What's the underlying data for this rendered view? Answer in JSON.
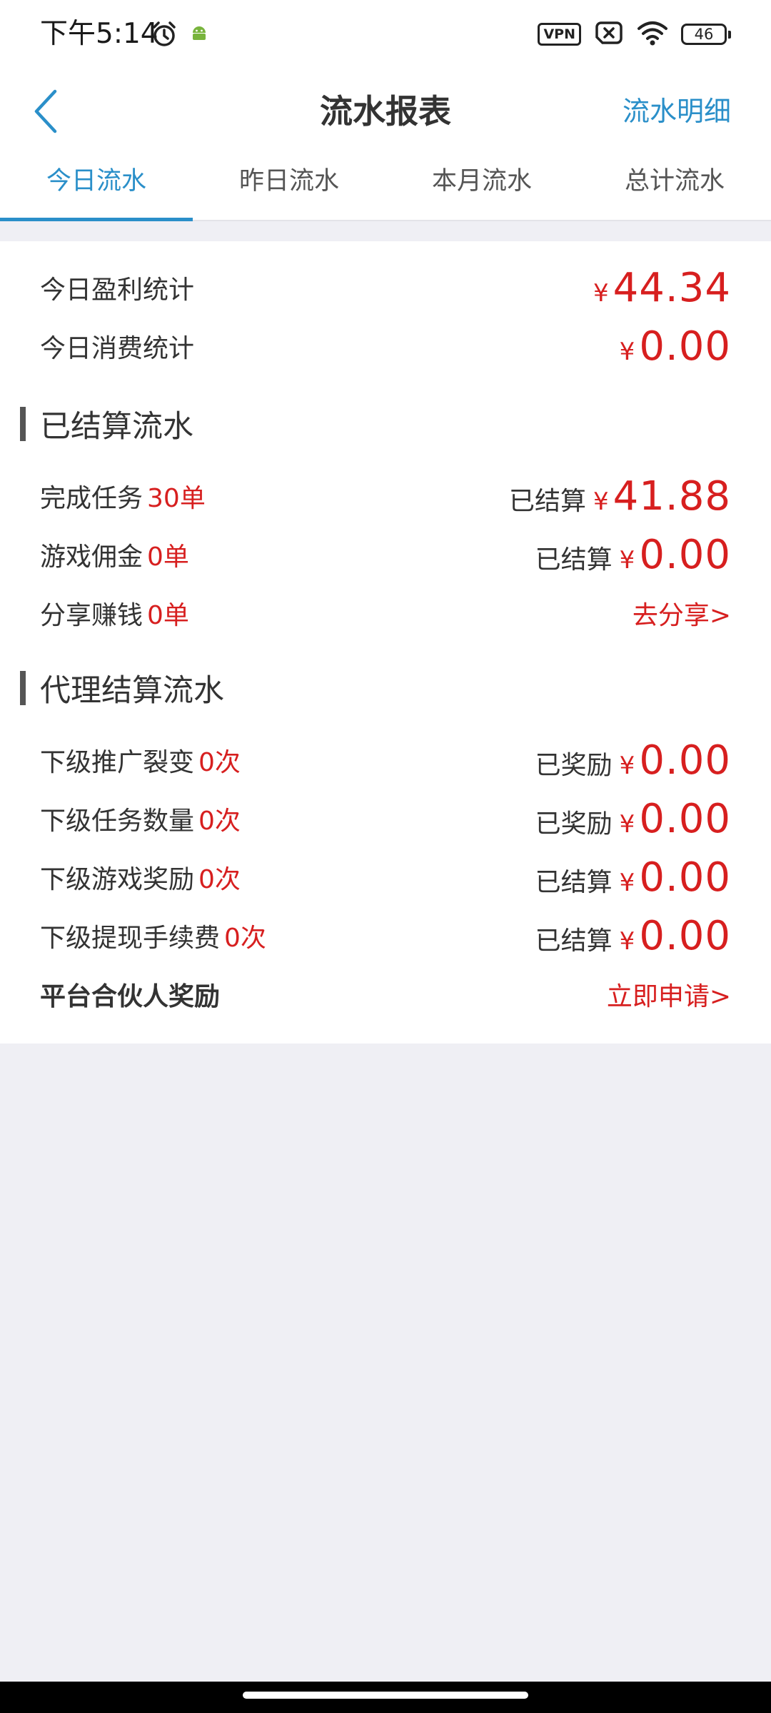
{
  "status_bar": {
    "time": "下午5:14",
    "vpn": "VPN",
    "battery": "46",
    "icons": [
      "alarm-icon",
      "android-icon",
      "sim-none-icon",
      "wifi-icon"
    ]
  },
  "header": {
    "title": "流水报表",
    "detail_link": "流水明细",
    "back_icon": "chevron-left-icon"
  },
  "tabs": [
    {
      "label": "今日流水",
      "active": true
    },
    {
      "label": "昨日流水",
      "active": false
    },
    {
      "label": "本月流水",
      "active": false
    },
    {
      "label": "总计流水",
      "active": false
    }
  ],
  "summary": {
    "profit": {
      "label": "今日盈利统计",
      "currency": "¥",
      "amount": "44.34"
    },
    "spend": {
      "label": "今日消费统计",
      "currency": "¥",
      "amount": "0.00"
    }
  },
  "settled": {
    "title": "已结算流水",
    "rows": [
      {
        "label": "完成任务",
        "count": "30单",
        "status": "已结算",
        "currency": "¥",
        "amount": "41.88"
      },
      {
        "label": "游戏佣金",
        "count": "0单",
        "status": "已结算",
        "currency": "¥",
        "amount": "0.00"
      },
      {
        "label": "分享赚钱",
        "count": "0单",
        "action": "去分享>"
      }
    ]
  },
  "agent": {
    "title": "代理结算流水",
    "rows": [
      {
        "label": "下级推广裂变",
        "count": "0次",
        "status": "已奖励",
        "currency": "¥",
        "amount": "0.00"
      },
      {
        "label": "下级任务数量",
        "count": "0次",
        "status": "已奖励",
        "currency": "¥",
        "amount": "0.00"
      },
      {
        "label": "下级游戏奖励",
        "count": "0次",
        "status": "已结算",
        "currency": "¥",
        "amount": "0.00"
      },
      {
        "label": "下级提现手续费",
        "count": "0次",
        "status": "已结算",
        "currency": "¥",
        "amount": "0.00"
      }
    ],
    "partner": {
      "label": "平台合伙人奖励",
      "action": "立即申请>"
    }
  },
  "colors": {
    "accent": "#2a8fc9",
    "money": "#d71f1f",
    "background": "#efeff4"
  }
}
